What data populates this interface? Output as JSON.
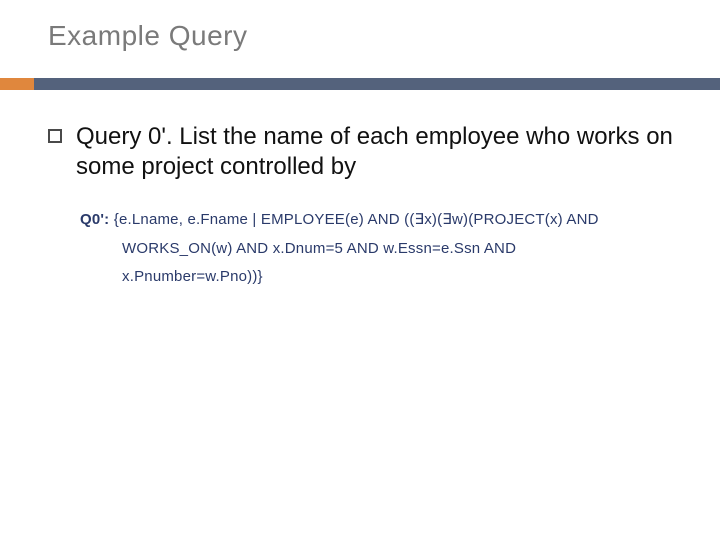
{
  "title": "Example Query",
  "bullet": "Query 0'. List the name of each employee who works on some project controlled by",
  "truncated_fragment": "",
  "formula": {
    "label": "Q0':",
    "line1_rest": " {e.Lname, e.Fname | EMPLOYEE(e) AND ((∃x)(∃w)(PROJECT(x) AND",
    "line2": "WORKS_ON(w) AND x.Dnum=5 AND w.Essn=e.Ssn AND",
    "line3": "x.Pnumber=w.Pno))}"
  }
}
